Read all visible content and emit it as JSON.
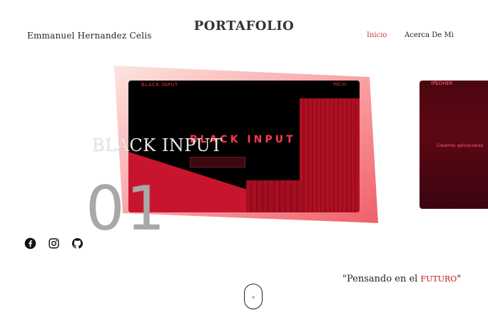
{
  "header": {
    "author": "Emmanuel Hernandez Celis",
    "brand": "PORTAFOLIO",
    "nav": [
      {
        "label": "Inicio",
        "active": true
      },
      {
        "label": "Acerca De Mi",
        "active": false
      }
    ]
  },
  "slider": {
    "current": {
      "title": "BLACK INPUT",
      "number": "01",
      "preview": {
        "logo": "BLACK INPUT",
        "nav": "INICIO",
        "title": "BLACK INPUT"
      }
    },
    "next": {
      "logo": "IPEDHER",
      "text": "Creamos aplicaciones"
    }
  },
  "social": [
    "facebook-icon",
    "instagram-icon",
    "github-icon"
  ],
  "quote": {
    "prefix": "\"Pensando en el ",
    "highlight": "FUTURO",
    "suffix": "\""
  },
  "colors": {
    "accent": "#c83a3a",
    "highlight": "#c01818",
    "number": "#a8a8a8"
  }
}
